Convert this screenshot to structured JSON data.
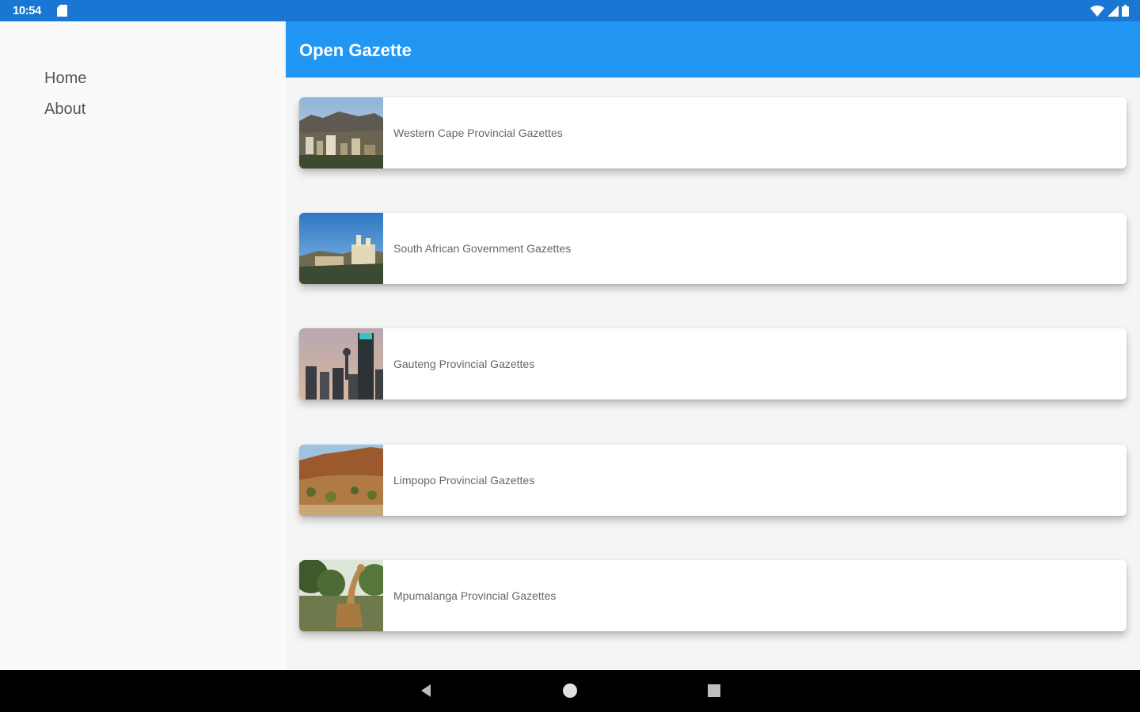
{
  "status_bar": {
    "time": "10:54",
    "icons": [
      "sd-card-icon",
      "wifi-icon",
      "cell-signal-icon",
      "battery-icon"
    ]
  },
  "drawer": {
    "items": [
      {
        "label": "Home"
      },
      {
        "label": "About"
      }
    ]
  },
  "app_bar": {
    "title": "Open Gazette"
  },
  "gazettes": [
    {
      "label": "Western Cape Provincial Gazettes",
      "thumbnail": "cape-town-city-photo"
    },
    {
      "label": "South African Government Gazettes",
      "thumbnail": "union-buildings-photo"
    },
    {
      "label": "Gauteng Provincial Gazettes",
      "thumbnail": "johannesburg-skyline-photo"
    },
    {
      "label": "Limpopo Provincial Gazettes",
      "thumbnail": "limpopo-landscape-photo"
    },
    {
      "label": "Mpumalanga Provincial Gazettes",
      "thumbnail": "giraffe-photo"
    }
  ],
  "nav_bar": {
    "buttons": [
      "back-icon",
      "home-icon",
      "recents-icon"
    ]
  },
  "colors": {
    "status_bar": "#1976d2",
    "app_bar": "#2196f3",
    "nav_bar": "#000000"
  }
}
